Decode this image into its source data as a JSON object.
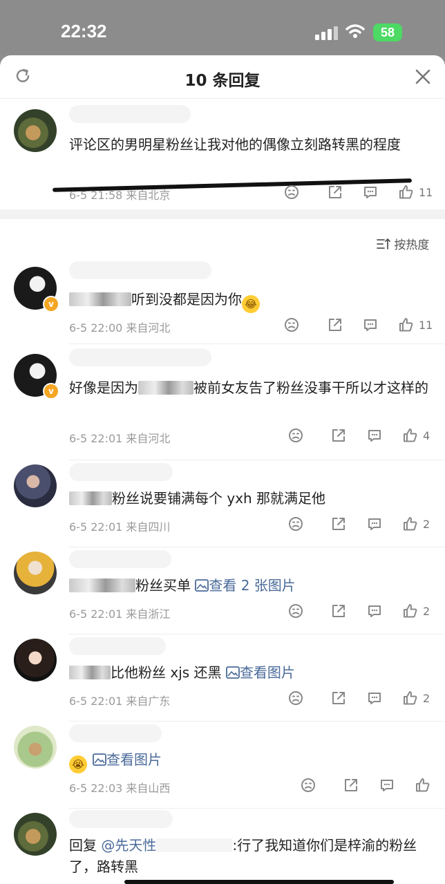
{
  "status_bar": {
    "time": "22:32",
    "battery": "58"
  },
  "header": {
    "title": "10 条回复"
  },
  "sort": {
    "label": "按热度"
  },
  "main_comment": {
    "text": "评论区的男明星粉丝让我对他的偶像立刻路转黑的程度",
    "meta": "6-5 21:58 来自北京",
    "likes": "11"
  },
  "replies": [
    {
      "text_after": "听到没都是因为你",
      "meta": "6-5 22:00 来自河北",
      "likes": "11"
    },
    {
      "text_pre": "好像是因为",
      "text_after": "被前女友告了粉丝没事干所以才这样的",
      "meta": "6-5 22:01 来自河北",
      "likes": "4"
    },
    {
      "text_after": "粉丝说要铺满每个 yxh 那就满足他",
      "meta": "6-5 22:01 来自四川",
      "likes": "2"
    },
    {
      "text_after": "粉丝买单",
      "link": "查看 2 张图片",
      "meta": "6-5 22:01 来自浙江",
      "likes": "2"
    },
    {
      "text_after": "比他粉丝 xjs 还黑",
      "link": "查看图片",
      "meta": "6-5 22:01 来自广东",
      "likes": "2"
    },
    {
      "link": "查看图片",
      "meta": "6-5 22:03 来自山西",
      "likes": ""
    },
    {
      "text_pre": "回复 ",
      "mention": "@先天性",
      "text_after": ":行了我知道你们是梓渝的粉丝了，路转黑"
    }
  ],
  "icons": [
    "refresh-icon",
    "close-icon",
    "dislike-icon",
    "share-icon",
    "comment-icon",
    "like-icon",
    "sort-icon",
    "image-icon",
    "verified-badge-icon"
  ]
}
